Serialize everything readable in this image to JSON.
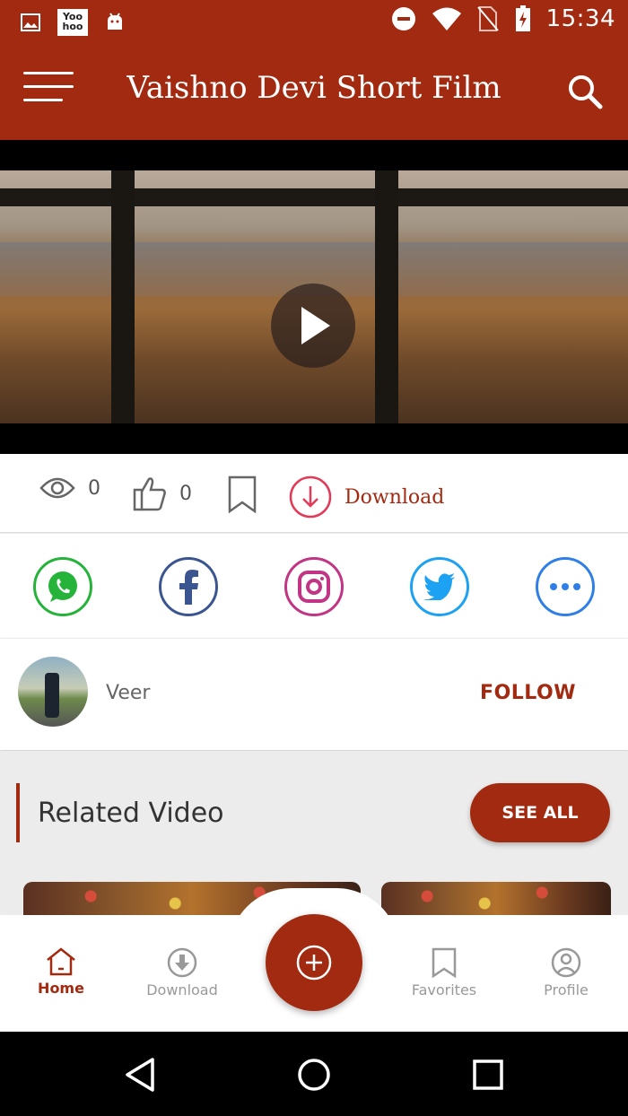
{
  "status_bar": {
    "time": "15:34",
    "notification_icon_label": "Yoo hoo"
  },
  "app_bar": {
    "title": "Vaishno Devi  Short Film"
  },
  "video": {
    "stats": {
      "views": "0",
      "likes": "0",
      "download_label": "Download"
    }
  },
  "share": {
    "targets": [
      "whatsapp",
      "facebook",
      "instagram",
      "twitter",
      "more"
    ]
  },
  "uploader": {
    "name": "Veer",
    "follow_label": "FOLLOW"
  },
  "related": {
    "heading": "Related Video",
    "see_all_label": "SEE ALL"
  },
  "bottom_nav": {
    "items": [
      {
        "label": "Home",
        "icon": "home-icon",
        "active": true
      },
      {
        "label": "Download",
        "icon": "download-icon",
        "active": false
      },
      {
        "label": "Favorites",
        "icon": "bookmark-icon",
        "active": false
      },
      {
        "label": "Profile",
        "icon": "profile-icon",
        "active": false
      }
    ]
  },
  "colors": {
    "primary": "#a22a10",
    "whatsapp": "#25b33a",
    "facebook": "#3b5591",
    "twitter": "#1da1f2",
    "more": "#2f7fe6"
  }
}
